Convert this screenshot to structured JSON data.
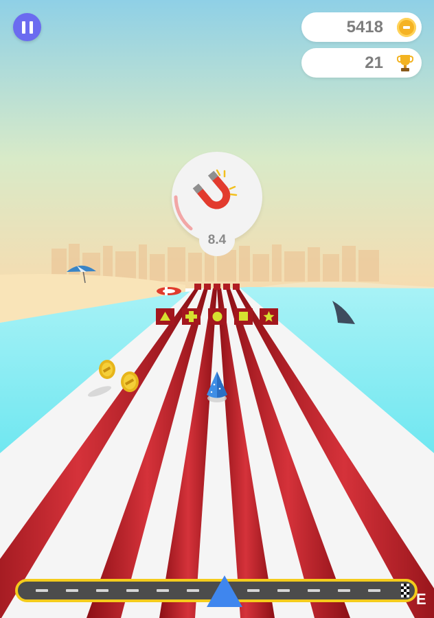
{
  "hud": {
    "coins": "5418",
    "trophies": "21",
    "pause_icon": "pause-icon",
    "coin_icon": "coin-icon",
    "trophy_icon": "trophy-icon"
  },
  "powerup": {
    "icon": "magnet-icon",
    "time_remaining": "8.4"
  },
  "progress": {
    "position": 0.52,
    "finish_icon": "checkered-flag-icon"
  },
  "gates": {
    "symbols": [
      "triangle",
      "plus",
      "circle",
      "square",
      "star"
    ]
  },
  "corner_text": "E",
  "colors": {
    "pause": "#6b6bf0",
    "coin": "#f5b323",
    "magnet_red": "#e23b2e",
    "rail_red": "#b81d25",
    "water": "#5fe7f2",
    "progress_border": "#f4cc1c",
    "marker_blue": "#3f86ee"
  }
}
